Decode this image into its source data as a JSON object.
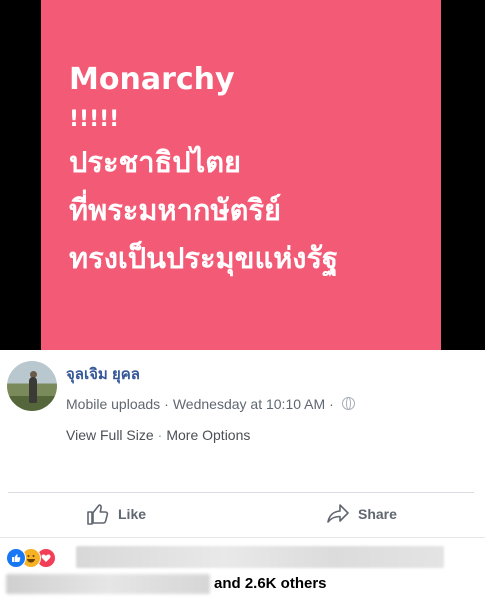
{
  "photo": {
    "lines": [
      "Monarchy",
      "!!!!!",
      "ประชาธิปไตย",
      "ที่พระมหากษัตริย์",
      "ทรงเป็นประมุขแห่งรัฐ"
    ]
  },
  "post": {
    "author": "จุลเจิม ยุคล",
    "album": "Mobile uploads",
    "timestamp": "Wednesday at 10:10 AM",
    "privacy_icon": "globe-icon",
    "view_full_size": "View Full Size",
    "more_options": "More Options"
  },
  "actions": {
    "like": "Like",
    "share": "Share"
  },
  "reactions": {
    "icons": [
      "like-reaction-icon",
      "haha-reaction-icon",
      "love-reaction-icon"
    ],
    "others_text": "and 2.6K others"
  },
  "colors": {
    "card_background": "#f25a76",
    "link_blue": "#365899",
    "like_blue": "#1877f2",
    "love_red": "#f33e58"
  }
}
